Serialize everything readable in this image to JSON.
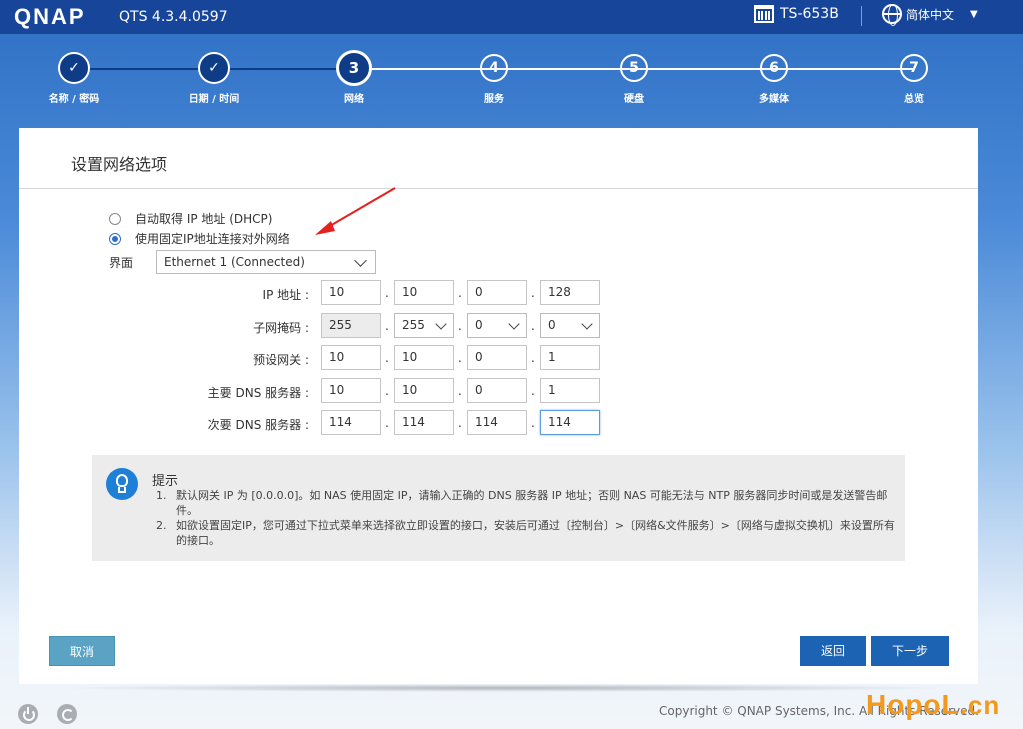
{
  "header": {
    "logo": "QNAP",
    "version": "QTS 4.3.4.0597",
    "model": "TS-653B",
    "language": "简体中文"
  },
  "steps": [
    {
      "num": "1",
      "label": "名称 / 密码",
      "state": "done"
    },
    {
      "num": "2",
      "label": "日期 / 时间",
      "state": "done"
    },
    {
      "num": "3",
      "label": "网络",
      "state": "current"
    },
    {
      "num": "4",
      "label": "服务",
      "state": "todo"
    },
    {
      "num": "5",
      "label": "硬盘",
      "state": "todo"
    },
    {
      "num": "6",
      "label": "多媒体",
      "state": "todo"
    },
    {
      "num": "7",
      "label": "总览",
      "state": "todo"
    }
  ],
  "card": {
    "title": "设置网络选项",
    "options": {
      "dhcp": "自动取得 IP 地址 (DHCP)",
      "static": "使用固定IP地址连接对外网络",
      "selected": "static"
    },
    "interface_label": "界面",
    "interface_value": "Ethernet 1 (Connected)",
    "rows": [
      {
        "label": "IP 地址 :",
        "values": [
          "10",
          "10",
          "0",
          "128"
        ]
      },
      {
        "label": "子网掩码 :",
        "values": [
          "255",
          "255",
          "0",
          "0"
        ]
      },
      {
        "label": "预设网关 :",
        "values": [
          "10",
          "10",
          "0",
          "1"
        ]
      },
      {
        "label": "主要 DNS 服务器 :",
        "values": [
          "10",
          "10",
          "0",
          "1"
        ]
      },
      {
        "label": "次要 DNS 服务器 :",
        "values": [
          "114",
          "114",
          "114",
          "114"
        ]
      }
    ],
    "dot": "."
  },
  "tip": {
    "title": "提示",
    "items": [
      {
        "num": "1.",
        "text": "默认网关 IP 为 [0.0.0.0]。如 NAS 使用固定 IP，请输入正确的 DNS 服务器 IP 地址；否则 NAS 可能无法与 NTP 服务器同步时间或是发送警告邮件。"
      },
      {
        "num": "2.",
        "text": "如欲设置固定IP，您可通过下拉式菜单来选择欲立即设置的接口，安装后可通过〔控制台〕>〔网络&文件服务〕>〔网络与虚拟交换机〕来设置所有的接口。"
      }
    ]
  },
  "buttons": {
    "cancel": "取消",
    "back": "返回",
    "next": "下一步"
  },
  "footer": {
    "copyright": "Copyright © QNAP Systems, Inc. All Rights Reserved.",
    "watermark_main": "HopoL",
    "watermark_dom": ".cn"
  },
  "colors": {
    "topbar": "#16459a",
    "step_done": "#0f3c87",
    "primary_button": "#1c63b4",
    "cancel_button": "#5aa3c4",
    "annotation_arrow": "#e52020"
  }
}
